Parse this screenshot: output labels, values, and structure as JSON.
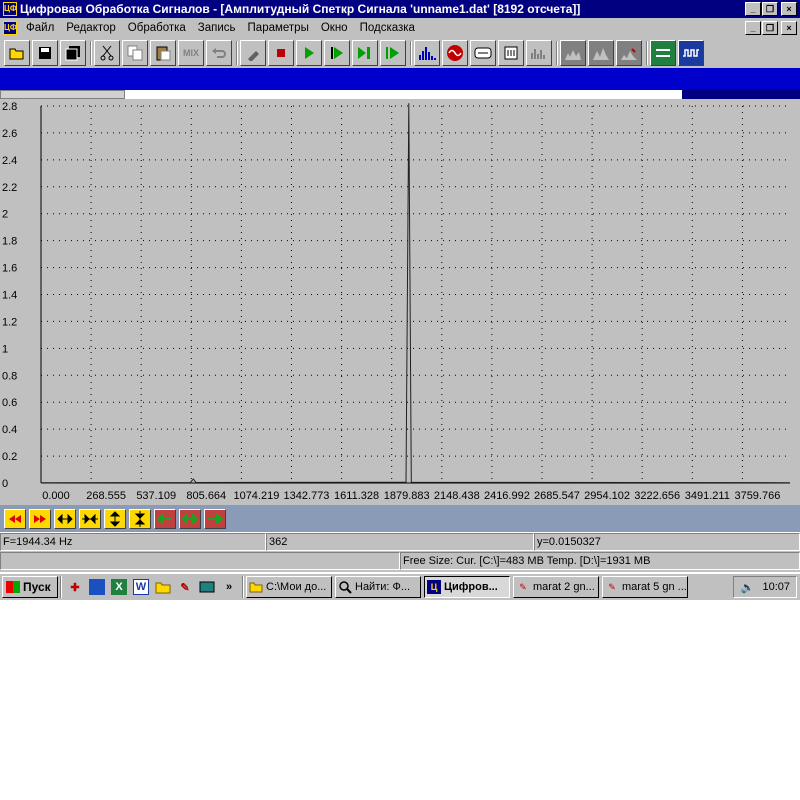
{
  "window": {
    "title": "Цифровая Обработка Сигналов - [Амплитудный Спеткр Сигнала 'unname1.dat' [8192 отсчета]]",
    "app_icon": "ЦФ"
  },
  "menu": [
    "Файл",
    "Редактор",
    "Обработка",
    "Запись",
    "Параметры",
    "Окно",
    "Подсказка"
  ],
  "toolbar_icons": [
    "open-icon",
    "save-icon",
    "save-all-icon",
    "cut-icon",
    "copy-icon",
    "paste-icon",
    "mix-icon",
    "undo-icon",
    "probe-icon",
    "stop-icon",
    "play-icon",
    "play-step-icon",
    "play-to-end-icon",
    "play-loop-icon",
    "spectrum-icon",
    "signal-icon",
    "filter1-icon",
    "filter2-icon",
    "filter3-icon",
    "graph1-icon",
    "graph2-icon",
    "graph3-icon",
    "channels-icon",
    "wave-icon"
  ],
  "toolbar_mix_label": "MIX",
  "chart_data": {
    "type": "line",
    "yticks": [
      "2.8",
      "2.6",
      "2.4",
      "2.2",
      "2",
      "1.8",
      "1.6",
      "1.4",
      "1.2",
      "1",
      "0.8",
      "0.6",
      "0.4",
      "0.2",
      "0"
    ],
    "xticks": [
      "0.000",
      "268.555",
      "537.109",
      "805.664",
      "1074.219",
      "1342.773",
      "1611.328",
      "1879.883",
      "2148.438",
      "2416.992",
      "2685.547",
      "2954.102",
      "3222.656",
      "3491.211",
      "3759.766"
    ],
    "ylim": [
      0,
      2.8
    ],
    "xlim": [
      0,
      3960
    ],
    "grid": true,
    "series": [
      {
        "points": [
          [
            0,
            0.002
          ],
          [
            790,
            0.004
          ],
          [
            805,
            0.03
          ],
          [
            820,
            0.004
          ],
          [
            1930,
            0.006
          ],
          [
            1944.34,
            2.82
          ],
          [
            1958,
            0.006
          ],
          [
            3960,
            0.002
          ]
        ]
      }
    ]
  },
  "nav_icons": [
    "rewind-icon",
    "fast-forward-icon",
    "expand-horizontal-icon",
    "compress-horizontal-icon",
    "expand-vertical-icon",
    "compress-vertical-icon",
    "arrow-left-icon",
    "arrow-both-icon",
    "arrow-right-icon"
  ],
  "status": {
    "frequency": "F=1944.34 Hz",
    "index": "362",
    "y_value": "y=0.0150327",
    "free_size": "Free Size: Cur. [C:\\]=483 MB Temp. [D:\\]=1931 MB"
  },
  "taskbar": {
    "start": "Пуск",
    "more": "»",
    "tasks": [
      {
        "label": "C:\\Мои до...",
        "icon": "folder-icon"
      },
      {
        "label": "Найти: Ф...",
        "icon": "find-icon"
      },
      {
        "label": "Цифров...",
        "icon": "app-icon",
        "active": true
      },
      {
        "label": "marat 2 gn...",
        "icon": "paint-icon"
      },
      {
        "label": "marat 5 gn ...",
        "icon": "paint-icon"
      }
    ],
    "time": "10:07"
  }
}
